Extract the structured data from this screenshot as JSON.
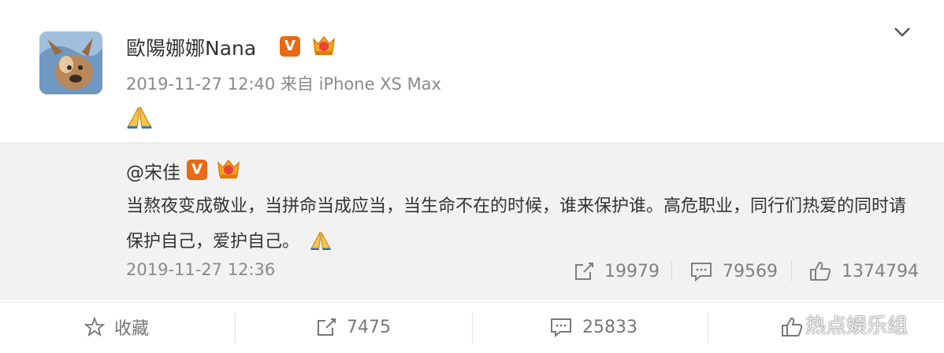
{
  "post": {
    "username": "歐陽娜娜Nana",
    "timestamp": "2019-11-27 12:40",
    "source": "来自 iPhone XS Max",
    "content_emoji": "pray-emoji"
  },
  "repost": {
    "mention": "@宋佳",
    "text": "当熬夜变成敬业，当拼命当成应当，当生命不在的时候，谁来保护谁。高危职业，同行们热爱的同时请保护自己，爱护自己。",
    "timestamp": "2019-11-27 12:36",
    "reposts": "19979",
    "comments": "79569",
    "likes": "1374794"
  },
  "actions": {
    "favorite_label": "收藏",
    "repost_count": "7475",
    "comment_count": "25833"
  },
  "watermark": "热点娱乐组",
  "colors": {
    "verified_badge": "#e86a14",
    "repost_background": "#f2f2f2",
    "meta_text": "#8a8a8a"
  }
}
